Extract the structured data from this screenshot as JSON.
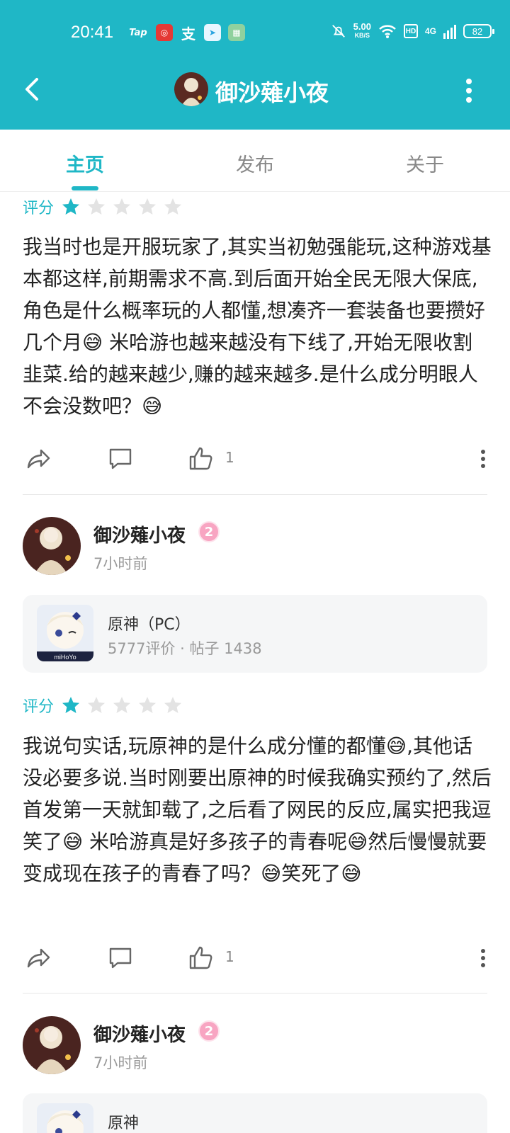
{
  "status_bar": {
    "time": "20:41",
    "speed_value": "5.00",
    "speed_unit": "KB/S",
    "hd": "HD",
    "network": "4G",
    "battery": "82"
  },
  "nav": {
    "title": "御沙薙小夜"
  },
  "tabs": [
    {
      "label": "主页",
      "active": true
    },
    {
      "label": "发布",
      "active": false
    },
    {
      "label": "关于",
      "active": false
    }
  ],
  "posts": [
    {
      "score_label": "评分",
      "rating": 1,
      "max_rating": 5,
      "text": "我当时也是开服玩家了,其实当初勉强能玩,这种游戏基本都这样,前期需求不高.到后面开始全民无限大保底,角色是什么概率玩的人都懂,想凑齐一套装备也要攒好几个月😅 米哈游也越来越没有下线了,开始无限收割韭菜.给的越来越少,赚的越来越多.是什么成分明眼人不会没数吧？😅",
      "like_count": "1"
    },
    {
      "author": {
        "name": "御沙薙小夜",
        "level": "2",
        "time": "7小时前"
      },
      "game": {
        "name": "原神（PC）",
        "stats": "5777评价 · 帖子 1438",
        "icon_label": "miHoYo"
      },
      "score_label": "评分",
      "rating": 1,
      "max_rating": 5,
      "text": "我说句实话,玩原神的是什么成分懂的都懂😅,其他话没必要多说.当时刚要出原神的时候我确实预约了,然后首发第一天就卸载了,之后看了网民的反应,属实把我逗笑了😅 米哈游真是好多孩子的青春呢😅然后慢慢就要变成现在孩子的青春了吗？😅笑死了😅",
      "like_count": "1"
    },
    {
      "author": {
        "name": "御沙薙小夜",
        "level": "2",
        "time": "7小时前"
      },
      "game": {
        "name": "原神"
      }
    }
  ],
  "colors": {
    "accent": "#1fb7c6",
    "star_empty": "#e3e3e3",
    "badge_pink": "#f8a5c2"
  }
}
